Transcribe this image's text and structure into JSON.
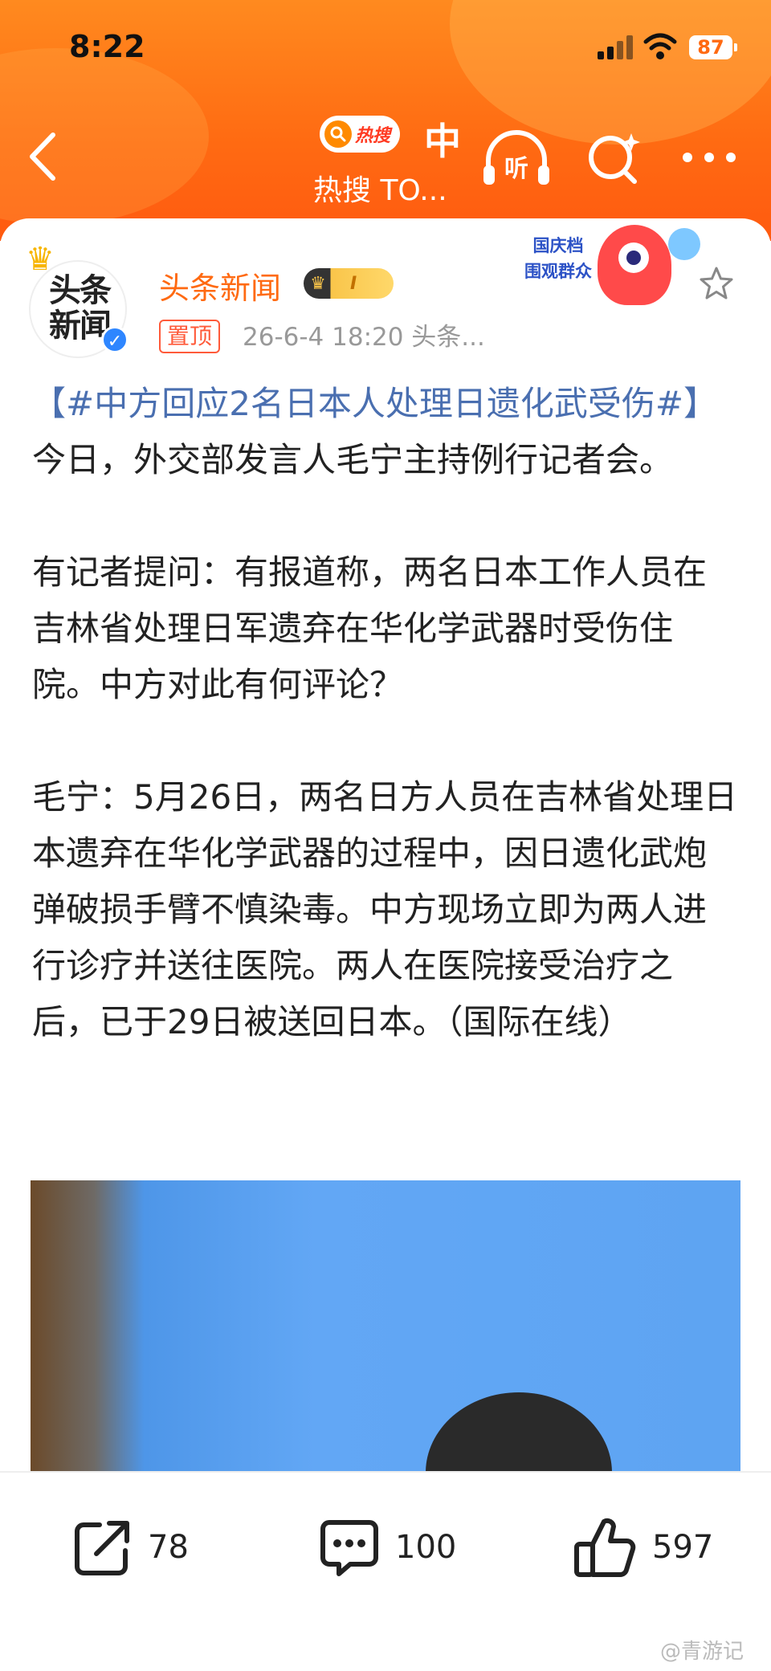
{
  "status_bar": {
    "time": "8:22",
    "battery": "87"
  },
  "nav": {
    "hot_badge_label": "热搜",
    "hot_char": "中",
    "hot_subtitle": "热搜 TO...",
    "listen_label": "听"
  },
  "post": {
    "author": "头条新闻",
    "avatar_logo_line1": "头条",
    "avatar_logo_line2": "新闻",
    "level": "I",
    "pinned_label": "置顶",
    "meta": "26-6-4 18:20  头条...",
    "promo_label": "国庆档\n围观群众",
    "topic": "【#中方回应2名日本人处理日遗化武受伤#】",
    "body": " 今日，外交部发言人毛宁主持例行记者会。\n\n有记者提问：有报道称，两名日本工作人员在吉林省处理日军遗弃在华化学武器时受伤住院。中方对此有何评论？\n\n毛宁：5月26日，两名日方人员在吉林省处理日本遗弃在华化学武器的过程中，因日遗化武炮弹破损手臂不慎染毒。中方现场立即为两人进行诊疗并送往医院。两人在医院接受治疗之后，已于29日被送回日本。（国际在线）"
  },
  "actions": {
    "share_count": "78",
    "comment_count": "100",
    "like_count": "597"
  },
  "watermark": "@青游记",
  "colors": {
    "accent": "#ff6a12",
    "topic_link": "#4a6fb0",
    "author": "#ff6a12"
  }
}
